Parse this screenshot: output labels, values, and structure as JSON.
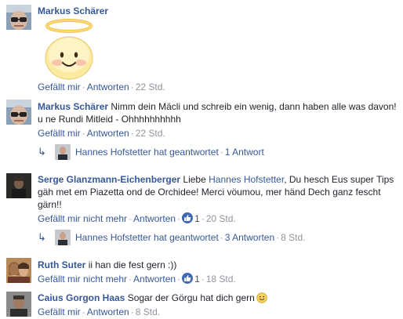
{
  "comments": [
    {
      "author": "Markus Schärer",
      "text": "",
      "sticker": "angel-smiley-sticker",
      "actions": {
        "like": "Gefällt mir",
        "reply": "Antworten",
        "time": "22 Std."
      }
    },
    {
      "author": "Markus Schärer",
      "text": "Nimm dein Mäcli und schreib ein wenig, dann haben alle was davon! u ne Rundi Mitleid - Ohhhhhhhhhh",
      "actions": {
        "like": "Gefällt mir",
        "reply": "Antworten",
        "time": "22 Std."
      },
      "reply_summary": {
        "text": "Hannes Hofstetter hat geantwortet",
        "count": "1 Antwort"
      }
    },
    {
      "author": "Serge Glanzmann-Eichenberger",
      "text_before": "Liebe",
      "mention": "Hannes Hofstetter",
      "text_after": ", Du hesch Eus super Tips gäh met em Piazetta ond de Orchidee! Merci vöumou, mer händ Dech ganz fescht gärn!!",
      "actions": {
        "like": "Gefällt mir nicht mehr",
        "reply": "Antworten",
        "likes": "1",
        "time": "20 Std."
      },
      "reply_summary": {
        "text": "Hannes Hofstetter hat geantwortet",
        "count": "3 Antworten",
        "time": "8 Std."
      }
    },
    {
      "author": "Ruth Suter",
      "text": "ii han die fest gern :))",
      "actions": {
        "like": "Gefällt mir nicht mehr",
        "reply": "Antworten",
        "likes": "1",
        "time": "18 Std."
      }
    },
    {
      "author": "Caius Gorgon Haas",
      "text": "Sogar der Görgu hat dich gern",
      "emoji": "slightly-smiling-emoji",
      "actions": {
        "like": "Gefällt mir",
        "reply": "Antworten",
        "time": "8 Std."
      }
    }
  ],
  "separator": "·",
  "colors": {
    "link": "#365899",
    "meta": "#90949c",
    "like_badge": "#4267b2"
  }
}
